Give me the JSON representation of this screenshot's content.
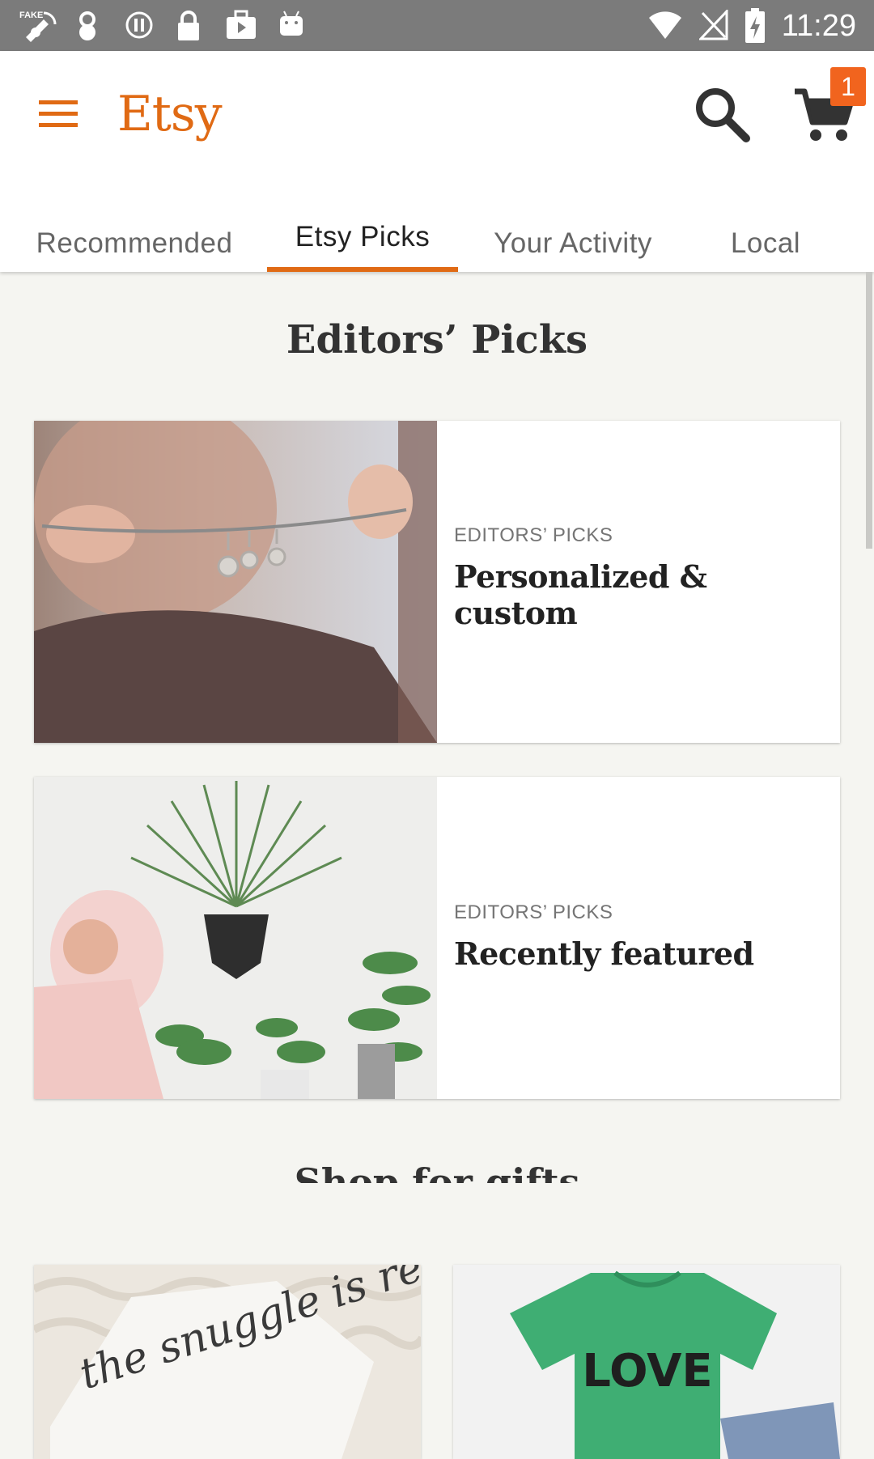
{
  "status_bar": {
    "time": "11:29",
    "icons": [
      "fake-gps-icon",
      "download-icon",
      "sync-icon",
      "lock-icon",
      "briefcase-play-icon",
      "android-icon",
      "wifi-icon",
      "no-signal-icon",
      "battery-charging-icon"
    ]
  },
  "app_bar": {
    "logo": "Etsy",
    "cart_count": "1"
  },
  "tabs": [
    {
      "label": "Recommended"
    },
    {
      "label": "Etsy Picks"
    },
    {
      "label": "Your Activity"
    },
    {
      "label": "Local"
    }
  ],
  "main": {
    "section_title": "Editors’ Picks",
    "cards": [
      {
        "eyebrow": "EDITORS’ PICKS",
        "title": "Personalized & custom"
      },
      {
        "eyebrow": "EDITORS’ PICKS",
        "title": "Recently featured"
      }
    ],
    "gifts_title": "Shop for gifts",
    "gift_tiles": [
      {
        "text": "the snuggle is real"
      },
      {
        "text": "LOVE"
      }
    ]
  },
  "colors": {
    "brand": "#e06a14",
    "badge": "#f1641e",
    "status_bar": "#7b7b7b",
    "background": "#f5f5f1"
  }
}
